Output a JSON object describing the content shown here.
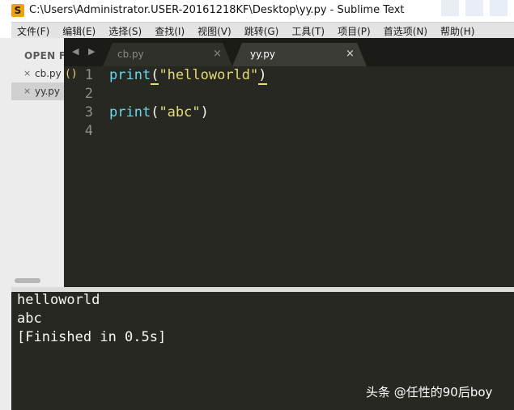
{
  "window": {
    "title": "C:\\Users\\Administrator.USER-20161218KF\\Desktop\\yy.py - Sublime Text",
    "app_icon_glyph": "S"
  },
  "menu": [
    "文件(F)",
    "编辑(E)",
    "选择(S)",
    "查找(I)",
    "视图(V)",
    "跳转(G)",
    "工具(T)",
    "项目(P)",
    "首选项(N)",
    "帮助(H)"
  ],
  "sidebar": {
    "header": "OPEN FI",
    "files": [
      {
        "close": "×",
        "name": "cb.py"
      },
      {
        "close": "×",
        "name": "yy.py"
      }
    ]
  },
  "tabs": {
    "nav": "◀ ▶",
    "items": [
      {
        "label": "cb.py",
        "close": "×"
      },
      {
        "label": "yy.py",
        "close": "×"
      }
    ]
  },
  "editor": {
    "bracket_indicator": "()",
    "lines": [
      {
        "number": "1",
        "func": "print",
        "open": "(",
        "string": "\"helloworld\"",
        "close": ")"
      },
      {
        "number": "2",
        "func": "",
        "open": "",
        "string": "",
        "close": ""
      },
      {
        "number": "3",
        "func": "print",
        "open": "(",
        "string": "\"abc\"",
        "close": ")"
      },
      {
        "number": "4",
        "func": "",
        "open": "",
        "string": "",
        "close": ""
      }
    ]
  },
  "console": {
    "lines": [
      "helloworld",
      "abc",
      "[Finished in 0.5s]"
    ]
  },
  "watermark": "头条 @任性的90后boy",
  "colors": {
    "editor_bg": "#272822",
    "keyword": "#66d9ef",
    "string": "#e6db74",
    "text": "#f8f8f2",
    "line_number": "#8f908a"
  }
}
